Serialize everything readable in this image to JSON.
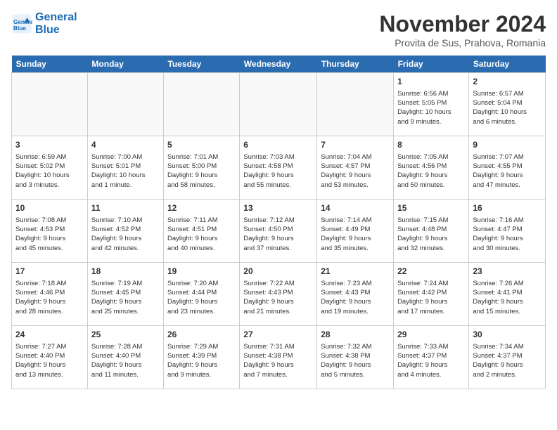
{
  "logo": {
    "line1": "General",
    "line2": "Blue"
  },
  "title": "November 2024",
  "subtitle": "Provita de Sus, Prahova, Romania",
  "weekdays": [
    "Sunday",
    "Monday",
    "Tuesday",
    "Wednesday",
    "Thursday",
    "Friday",
    "Saturday"
  ],
  "weeks": [
    [
      {
        "day": "",
        "info": ""
      },
      {
        "day": "",
        "info": ""
      },
      {
        "day": "",
        "info": ""
      },
      {
        "day": "",
        "info": ""
      },
      {
        "day": "",
        "info": ""
      },
      {
        "day": "1",
        "info": "Sunrise: 6:56 AM\nSunset: 5:05 PM\nDaylight: 10 hours\nand 9 minutes."
      },
      {
        "day": "2",
        "info": "Sunrise: 6:57 AM\nSunset: 5:04 PM\nDaylight: 10 hours\nand 6 minutes."
      }
    ],
    [
      {
        "day": "3",
        "info": "Sunrise: 6:59 AM\nSunset: 5:02 PM\nDaylight: 10 hours\nand 3 minutes."
      },
      {
        "day": "4",
        "info": "Sunrise: 7:00 AM\nSunset: 5:01 PM\nDaylight: 10 hours\nand 1 minute."
      },
      {
        "day": "5",
        "info": "Sunrise: 7:01 AM\nSunset: 5:00 PM\nDaylight: 9 hours\nand 58 minutes."
      },
      {
        "day": "6",
        "info": "Sunrise: 7:03 AM\nSunset: 4:58 PM\nDaylight: 9 hours\nand 55 minutes."
      },
      {
        "day": "7",
        "info": "Sunrise: 7:04 AM\nSunset: 4:57 PM\nDaylight: 9 hours\nand 53 minutes."
      },
      {
        "day": "8",
        "info": "Sunrise: 7:05 AM\nSunset: 4:56 PM\nDaylight: 9 hours\nand 50 minutes."
      },
      {
        "day": "9",
        "info": "Sunrise: 7:07 AM\nSunset: 4:55 PM\nDaylight: 9 hours\nand 47 minutes."
      }
    ],
    [
      {
        "day": "10",
        "info": "Sunrise: 7:08 AM\nSunset: 4:53 PM\nDaylight: 9 hours\nand 45 minutes."
      },
      {
        "day": "11",
        "info": "Sunrise: 7:10 AM\nSunset: 4:52 PM\nDaylight: 9 hours\nand 42 minutes."
      },
      {
        "day": "12",
        "info": "Sunrise: 7:11 AM\nSunset: 4:51 PM\nDaylight: 9 hours\nand 40 minutes."
      },
      {
        "day": "13",
        "info": "Sunrise: 7:12 AM\nSunset: 4:50 PM\nDaylight: 9 hours\nand 37 minutes."
      },
      {
        "day": "14",
        "info": "Sunrise: 7:14 AM\nSunset: 4:49 PM\nDaylight: 9 hours\nand 35 minutes."
      },
      {
        "day": "15",
        "info": "Sunrise: 7:15 AM\nSunset: 4:48 PM\nDaylight: 9 hours\nand 32 minutes."
      },
      {
        "day": "16",
        "info": "Sunrise: 7:16 AM\nSunset: 4:47 PM\nDaylight: 9 hours\nand 30 minutes."
      }
    ],
    [
      {
        "day": "17",
        "info": "Sunrise: 7:18 AM\nSunset: 4:46 PM\nDaylight: 9 hours\nand 28 minutes."
      },
      {
        "day": "18",
        "info": "Sunrise: 7:19 AM\nSunset: 4:45 PM\nDaylight: 9 hours\nand 25 minutes."
      },
      {
        "day": "19",
        "info": "Sunrise: 7:20 AM\nSunset: 4:44 PM\nDaylight: 9 hours\nand 23 minutes."
      },
      {
        "day": "20",
        "info": "Sunrise: 7:22 AM\nSunset: 4:43 PM\nDaylight: 9 hours\nand 21 minutes."
      },
      {
        "day": "21",
        "info": "Sunrise: 7:23 AM\nSunset: 4:43 PM\nDaylight: 9 hours\nand 19 minutes."
      },
      {
        "day": "22",
        "info": "Sunrise: 7:24 AM\nSunset: 4:42 PM\nDaylight: 9 hours\nand 17 minutes."
      },
      {
        "day": "23",
        "info": "Sunrise: 7:26 AM\nSunset: 4:41 PM\nDaylight: 9 hours\nand 15 minutes."
      }
    ],
    [
      {
        "day": "24",
        "info": "Sunrise: 7:27 AM\nSunset: 4:40 PM\nDaylight: 9 hours\nand 13 minutes."
      },
      {
        "day": "25",
        "info": "Sunrise: 7:28 AM\nSunset: 4:40 PM\nDaylight: 9 hours\nand 11 minutes."
      },
      {
        "day": "26",
        "info": "Sunrise: 7:29 AM\nSunset: 4:39 PM\nDaylight: 9 hours\nand 9 minutes."
      },
      {
        "day": "27",
        "info": "Sunrise: 7:31 AM\nSunset: 4:38 PM\nDaylight: 9 hours\nand 7 minutes."
      },
      {
        "day": "28",
        "info": "Sunrise: 7:32 AM\nSunset: 4:38 PM\nDaylight: 9 hours\nand 5 minutes."
      },
      {
        "day": "29",
        "info": "Sunrise: 7:33 AM\nSunset: 4:37 PM\nDaylight: 9 hours\nand 4 minutes."
      },
      {
        "day": "30",
        "info": "Sunrise: 7:34 AM\nSunset: 4:37 PM\nDaylight: 9 hours\nand 2 minutes."
      }
    ]
  ]
}
